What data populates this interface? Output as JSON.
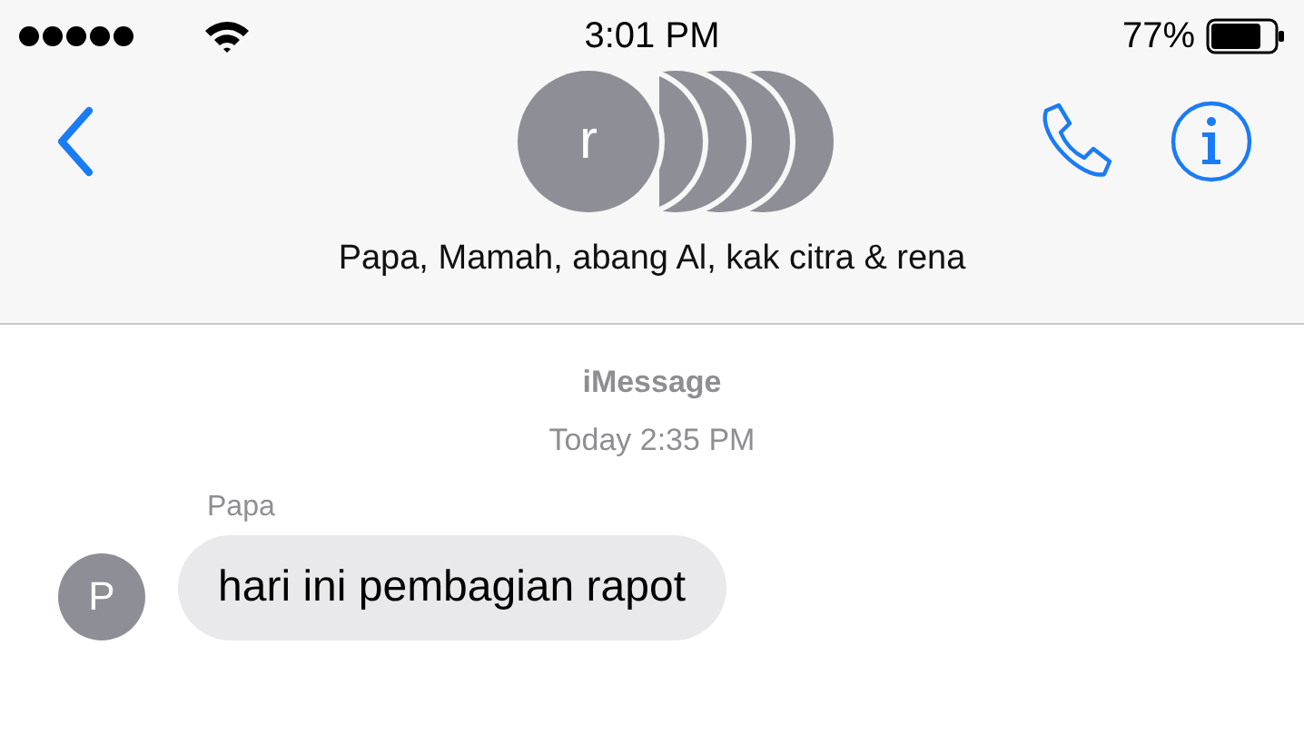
{
  "status_bar": {
    "time": "3:01 PM",
    "battery": "77%"
  },
  "header": {
    "avatar_initial": "r",
    "group_name": "Papa, Mamah, abang Al, kak citra & rena"
  },
  "conversation": {
    "service": "iMessage",
    "timestamp": "Today 2:35 PM",
    "messages": [
      {
        "sender": "Papa",
        "avatar_initial": "P",
        "text": "hari ini pembagian rapot"
      }
    ]
  }
}
